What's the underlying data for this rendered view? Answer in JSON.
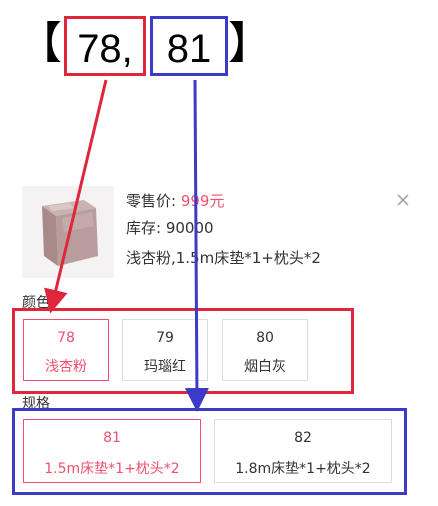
{
  "header": {
    "bracket_open": "【",
    "bracket_close": "】",
    "color_code": "78,",
    "size_code": "81"
  },
  "product": {
    "price_label": "零售价:",
    "price_value": "999元",
    "stock_label": "库存:",
    "stock_value": "90000",
    "selected_spec": "浅杏粉,1.5m床垫*1+枕头*2",
    "close_icon": "close-icon"
  },
  "color_section": {
    "label": "颜色",
    "options": [
      {
        "code": "78",
        "name": "浅杏粉",
        "selected": true
      },
      {
        "code": "79",
        "name": "玛瑙红",
        "selected": false
      },
      {
        "code": "80",
        "name": "烟白灰",
        "selected": false
      }
    ]
  },
  "size_section": {
    "label": "规格",
    "options": [
      {
        "code": "81",
        "name": "1.5m床垫*1+枕头*2",
        "selected": true
      },
      {
        "code": "82",
        "name": "1.8m床垫*1+枕头*2",
        "selected": false
      }
    ]
  },
  "colors": {
    "accent": "#f0506e",
    "highlight_red": "#e0263a",
    "highlight_blue": "#3b3bc8"
  }
}
